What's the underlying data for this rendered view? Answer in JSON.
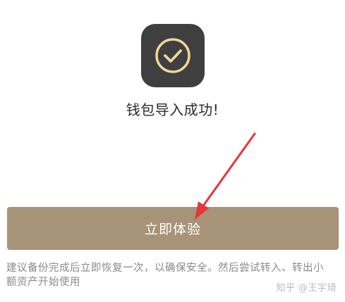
{
  "success": {
    "icon": "check-circle-icon",
    "title": "钱包导入成功!"
  },
  "cta": {
    "label": "立即体验"
  },
  "hint": {
    "text": "建议备份完成后立即恢复一次，以确保安全。然后尝试转入、转出小额资产开始使用"
  },
  "watermark": {
    "text": "知乎 @王宇琦"
  },
  "colors": {
    "icon_bg": "#3f3f3f",
    "icon_stroke": "#f0d79a",
    "button": "#a79378",
    "arrow": "#e8343a",
    "hint_text": "#8a8a8a"
  }
}
